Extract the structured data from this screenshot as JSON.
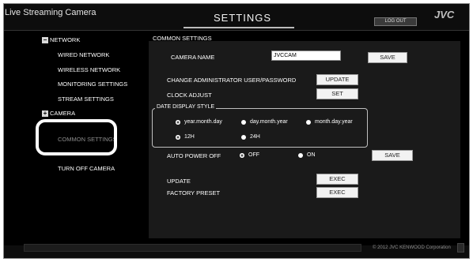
{
  "header": {
    "app_title": "Live Streaming Camera",
    "page_title": "SETTINGS",
    "logout_label": "LOG OUT",
    "brand": "JVC"
  },
  "sidebar": {
    "network_label": "NETWORK",
    "network_icon": "minus-box-icon",
    "network_items": [
      "WIRED NETWORK",
      "WIRELESS NETWORK",
      "MONITORING SETTINGS",
      "STREAM SETTINGS"
    ],
    "camera_label": "CAMERA",
    "camera_icon": "plus-box-icon",
    "camera_items": [
      "COMMON SETTINGS"
    ],
    "turn_off": "TURN OFF CAMERA"
  },
  "main": {
    "section_title": "COMMON SETTINGS",
    "camera_name_label": "CAMERA NAME",
    "camera_name_value": "JVCCAM",
    "save_label": "SAVE",
    "change_admin_label": "CHANGE ADMINISTRATOR USER/PASSWORD",
    "update_label": "UPDATE",
    "clock_adjust_label": "CLOCK ADJUST",
    "set_label": "SET",
    "date_display_style": {
      "legend": "DATE DISPLAY STYLE",
      "formats": [
        "year.month.day",
        "day.month.year",
        "month.day.year"
      ],
      "selected_format": "year.month.day",
      "clocks": [
        "12H",
        "24H"
      ],
      "selected_clock": "12H"
    },
    "auto_power_off": {
      "label": "AUTO POWER OFF",
      "options": [
        "OFF",
        "ON"
      ],
      "selected": "OFF"
    },
    "save2_label": "SAVE",
    "update_fw_label": "UPDATE",
    "exec_label": "EXEC",
    "factory_preset_label": "FACTORY PRESET",
    "exec2_label": "EXEC"
  },
  "footer": {
    "copyright": "© 2012 JVC KENWOOD Corporation"
  }
}
